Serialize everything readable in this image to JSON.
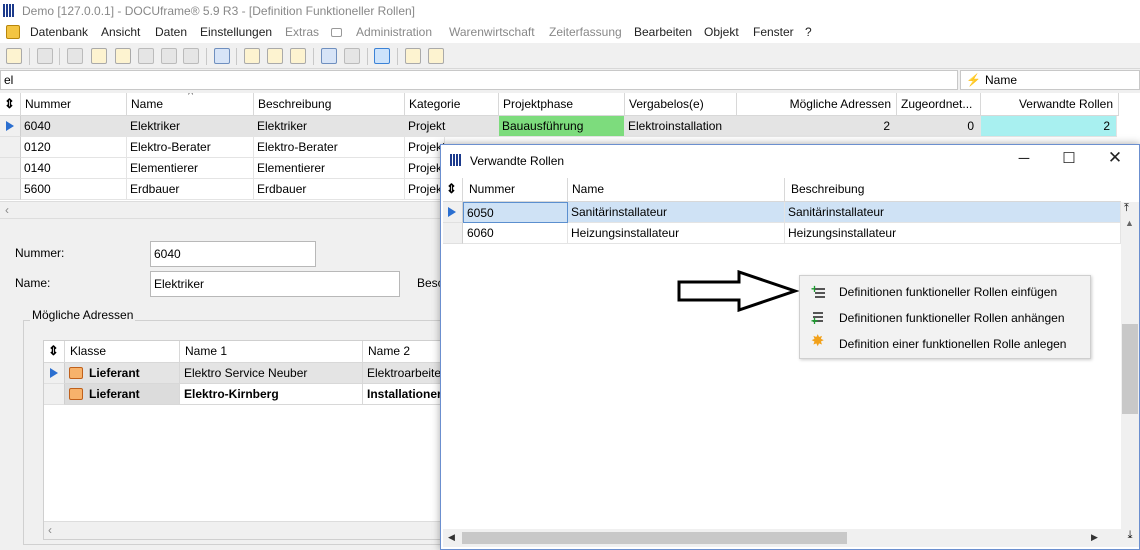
{
  "window": {
    "title": "Demo [127.0.0.1] - DOCUframe® 5.9 R3 - [Definition Funktioneller Rollen]"
  },
  "menu": {
    "items": [
      "Datenbank",
      "Ansicht",
      "Daten",
      "Einstellungen",
      "Extras",
      "Administration",
      "Warenwirtschaft",
      "Zeiterfassung",
      "Bearbeiten",
      "Objekt",
      "Fenster",
      "?"
    ]
  },
  "filter": {
    "value": "el",
    "name_label": "Name"
  },
  "main_grid": {
    "columns": [
      "Nummer",
      "Name",
      "Beschreibung",
      "Kategorie",
      "Projektphase",
      "Vergabelos(e)",
      "Mögliche Adressen",
      "Zugeordnet...",
      "Verwandte Rollen"
    ],
    "rows": [
      {
        "nummer": "6040",
        "name": "Elektriker",
        "beschreibung": "Elektriker",
        "kategorie": "Projekt",
        "projektphase": "Bauausführung",
        "vergabelos": "Elektroinstallation",
        "adressen": "2",
        "zugeordnet": "0",
        "verwandte": "2"
      },
      {
        "nummer": "0120",
        "name": "Elektro-Berater",
        "beschreibung": "Elektro-Berater",
        "kategorie": "Projekt",
        "projektphase": "",
        "vergabelos": "",
        "adressen": "",
        "zugeordnet": "",
        "verwandte": ""
      },
      {
        "nummer": "0140",
        "name": "Elementierer",
        "beschreibung": "Elementierer",
        "kategorie": "Projekt",
        "projektphase": "",
        "vergabelos": "",
        "adressen": "",
        "zugeordnet": "",
        "verwandte": ""
      },
      {
        "nummer": "5600",
        "name": "Erdbauer",
        "beschreibung": "Erdbauer",
        "kategorie": "Projekt",
        "projektphase": "",
        "vergabelos": "",
        "adressen": "",
        "zugeordnet": "",
        "verwandte": ""
      }
    ],
    "phase_color": "#7ddc7d",
    "verwandte_color": "#a8f0f0"
  },
  "detail": {
    "nummer_label": "Nummer:",
    "nummer_value": "6040",
    "name_label": "Name:",
    "name_value": "Elektriker",
    "beschreibung_label": "Besc",
    "group_title": "Mögliche Adressen",
    "address_grid": {
      "columns": [
        "Klasse",
        "Name 1",
        "Name 2"
      ],
      "rows": [
        {
          "klasse": "Lieferant",
          "name1": "Elektro Service Neuber",
          "name2": "Elektroarbeite"
        },
        {
          "klasse": "Lieferant",
          "name1": "Elektro-Kirnberg",
          "name2": "Installationer"
        }
      ]
    }
  },
  "dialog": {
    "title": "Verwandte Rollen",
    "columns": [
      "Nummer",
      "Name",
      "Beschreibung"
    ],
    "rows": [
      {
        "nummer": "6050",
        "name": "Sanitärinstallateur",
        "beschreibung": "Sanitärinstallateur"
      },
      {
        "nummer": "6060",
        "name": "Heizungsinstallateur",
        "beschreibung": "Heizungsinstallateur"
      }
    ],
    "context_menu": [
      {
        "label": "Definitionen funktioneller Rollen einfügen",
        "icon": "insert-list-icon"
      },
      {
        "label": "Definitionen funktioneller Rollen anhängen",
        "icon": "append-list-icon"
      },
      {
        "label": "Definition einer funktionellen Rolle anlegen",
        "icon": "new-star-icon"
      }
    ]
  }
}
